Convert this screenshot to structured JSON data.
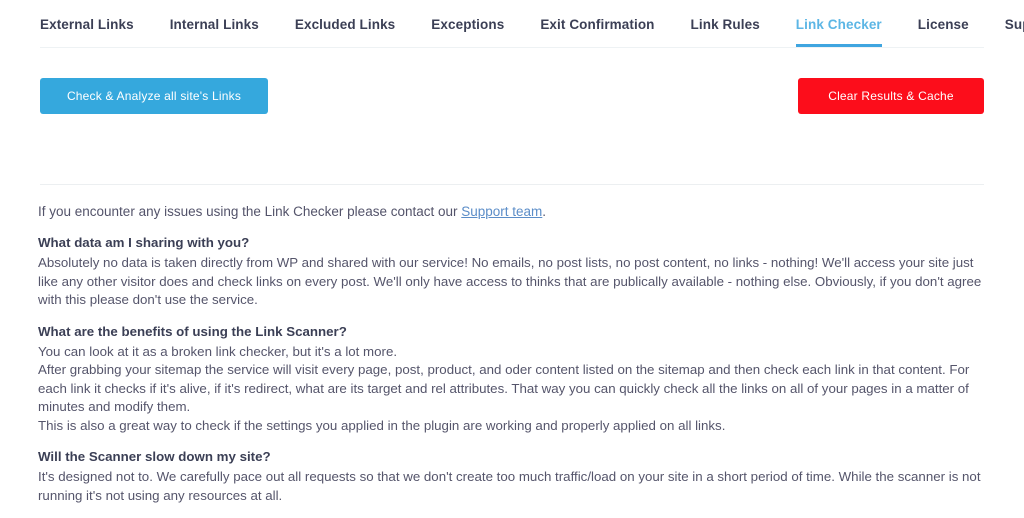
{
  "tabs": [
    {
      "label": "External Links",
      "active": false
    },
    {
      "label": "Internal Links",
      "active": false
    },
    {
      "label": "Excluded Links",
      "active": false
    },
    {
      "label": "Exceptions",
      "active": false
    },
    {
      "label": "Exit Confirmation",
      "active": false
    },
    {
      "label": "Link Rules",
      "active": false
    },
    {
      "label": "Link Checker",
      "active": true
    },
    {
      "label": "License",
      "active": false
    },
    {
      "label": "Support",
      "active": false
    }
  ],
  "actions": {
    "check_label": "Check & Analyze all site's Links",
    "clear_label": "Clear Results & Cache",
    "check_color": "#35a8dd",
    "clear_color": "#fc0d1b"
  },
  "intro": {
    "before_link": "If you encounter any issues using the Link Checker please contact our ",
    "link_text": "Support team",
    "after_link": ".",
    "link_color": "#5b8dc8"
  },
  "faq": [
    {
      "question": "What data am I sharing with you?",
      "answers": [
        "Absolutely no data is taken directly from WP and shared with our service! No emails, no post lists, no post content, no links - nothing! We'll access your site just like any other visitor does and check links on every post. We'll only have access to thinks that are publically available - nothing else. Obviously, if you don't agree with this please don't use the service."
      ]
    },
    {
      "question": "What are the benefits of using the Link Scanner?",
      "answers": [
        "You can look at it as a broken link checker, but it's a lot more.",
        "After grabbing your sitemap the service will visit every page, post, product, and oder content listed on the sitemap and then check each link in that content. For each link it checks if it's alive, if it's redirect, what are its target and rel attributes. That way you can quickly check all the links on all of your pages in a matter of minutes and modify them.",
        "This is also a great way to check if the settings you applied in the plugin are working and properly applied on all links."
      ]
    },
    {
      "question": "Will the Scanner slow down my site?",
      "answers": [
        "It's designed not to. We carefully pace out all requests so that we don't create too much traffic/load on your site in a short period of time. While the scanner is not running it's not using any resources at all."
      ]
    }
  ]
}
